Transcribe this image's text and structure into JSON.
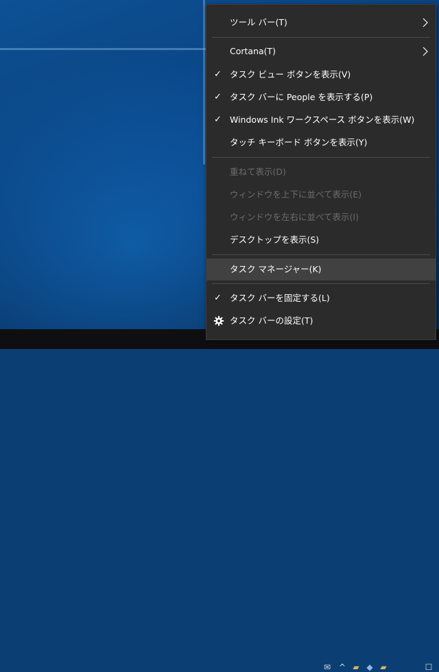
{
  "menu": {
    "items": [
      {
        "label": "ツール バー(T)",
        "submenu": true
      },
      {
        "label": "Cortana(T)",
        "submenu": true
      },
      {
        "label": "タスク ビュー ボタンを表示(V)",
        "checked": true
      },
      {
        "label": "タスク バーに People を表示する(P)",
        "checked": true
      },
      {
        "label": "Windows Ink ワークスペース ボタンを表示(W)",
        "checked": true
      },
      {
        "label": "タッチ キーボード ボタンを表示(Y)"
      },
      {
        "label": "重ねて表示(D)",
        "disabled": true
      },
      {
        "label": "ウィンドウを上下に並べて表示(E)",
        "disabled": true
      },
      {
        "label": "ウィンドウを左右に並べて表示(I)",
        "disabled": true
      },
      {
        "label": "デスクトップを表示(S)"
      },
      {
        "label": "タスク マネージャー(K)",
        "highlighted": true
      },
      {
        "label": "タスク バーを固定する(L)",
        "checked": true
      },
      {
        "label": "タスク バーの設定(T)",
        "icon": "gear-icon"
      }
    ],
    "check_glyph": "✓"
  },
  "colors": {
    "menu_background": "#2b2b2b",
    "highlight": "#414141",
    "disabled_text": "#6d6d6d",
    "desktop_blue": "#0a3f7a"
  }
}
